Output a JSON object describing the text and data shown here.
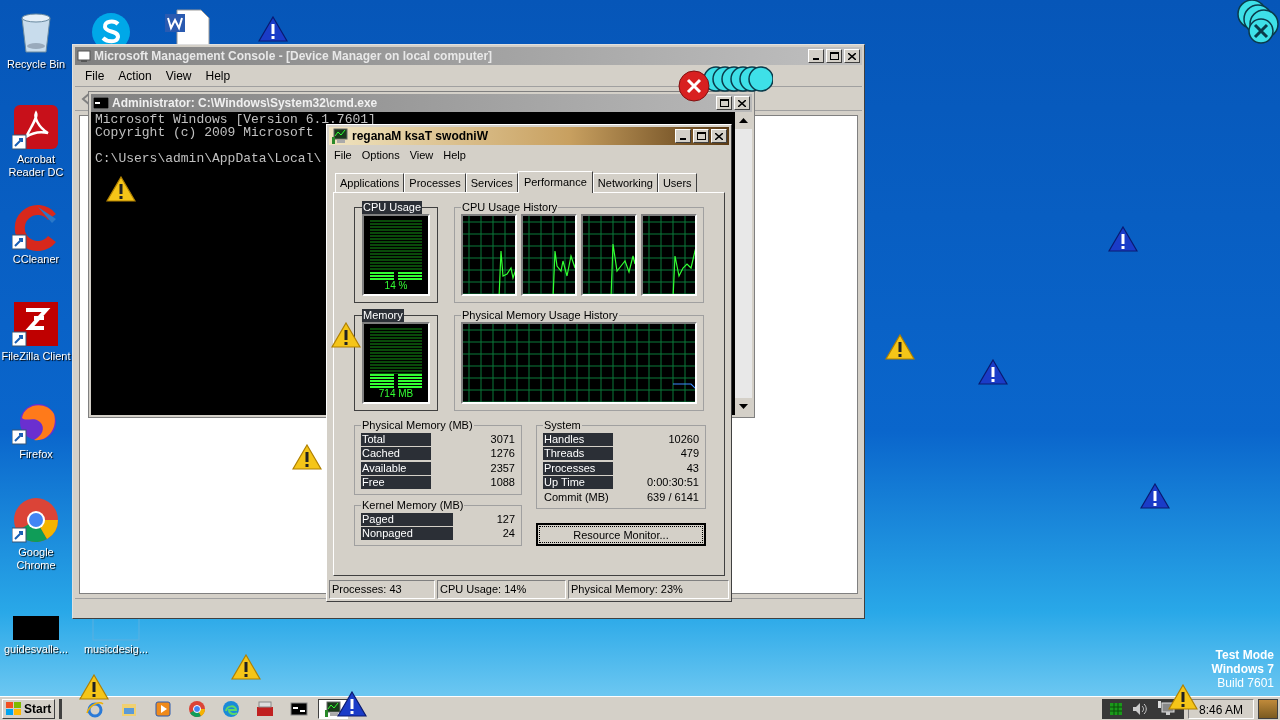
{
  "desktop_icons": [
    {
      "kind": "recycle",
      "label": "Recycle Bin"
    },
    {
      "kind": "acrobat",
      "label": "Acrobat Reader DC"
    },
    {
      "kind": "ccleaner",
      "label": "CCleaner"
    },
    {
      "kind": "filezilla",
      "label": "FileZilla Client"
    },
    {
      "kind": "firefox",
      "label": "Firefox"
    },
    {
      "kind": "chrome",
      "label": "Google Chrome"
    },
    {
      "kind": "black",
      "label": "guidesvalle..."
    },
    {
      "kind": "blank",
      "label": "musicdesig..."
    }
  ],
  "mmc": {
    "title": "Microsoft Management Console - [Device Manager on local computer]",
    "menu": [
      "File",
      "Action",
      "View",
      "Help"
    ]
  },
  "cmd": {
    "title": "Administrator: C:\\Windows\\System32\\cmd.exe",
    "blocks": [
      [
        "Microsoft Windows [Version 6.1.7601]",
        "Copyright (c) 2009 Microsoft"
      ],
      [
        "C:\\Users\\admin\\AppData\\Local\\"
      ]
    ]
  },
  "task_manager": {
    "title": "reganaM ksaT swodniW",
    "menu": [
      "File",
      "Options",
      "View",
      "Help"
    ],
    "tabs": [
      {
        "label": "Applications",
        "selected": false
      },
      {
        "label": "Processes",
        "selected": false
      },
      {
        "label": "Services",
        "selected": false
      },
      {
        "label": "Performance",
        "selected": true
      },
      {
        "label": "Networking",
        "selected": false
      },
      {
        "label": "Users",
        "selected": false
      }
    ],
    "cpu_usage": {
      "title": "CPU Usage",
      "reading": "14 %",
      "level": 0.14
    },
    "cpu_history": {
      "title": "CPU Usage History"
    },
    "memory": {
      "title": "Memory",
      "reading": "714 MB",
      "level": 0.23
    },
    "memory_history": {
      "title": "Physical Memory Usage History"
    },
    "physical_memory": {
      "title": "Physical Memory (MB)",
      "rows": [
        {
          "label": "Total",
          "value": "3071",
          "highlighted": true
        },
        {
          "label": "Cached",
          "value": "1276",
          "highlighted": true
        },
        {
          "label": "Available",
          "value": "2357",
          "highlighted": true
        },
        {
          "label": "Free",
          "value": "1088",
          "highlighted": true
        }
      ]
    },
    "kernel_memory": {
      "title": "Kernel Memory (MB)",
      "rows": [
        {
          "label": "Paged",
          "value": "127",
          "highlighted": true
        },
        {
          "label": "Nonpaged",
          "value": "24",
          "highlighted": true
        }
      ]
    },
    "system": {
      "title": "System",
      "rows": [
        {
          "label": "Handles",
          "value": "10260",
          "highlighted": true
        },
        {
          "label": "Threads",
          "value": "479",
          "highlighted": true
        },
        {
          "label": "Processes",
          "value": "43",
          "highlighted": true
        },
        {
          "label": "Up Time",
          "value": "0:00:30:51",
          "highlighted": true
        },
        {
          "label": "Commit (MB)",
          "value": "639 / 6141",
          "highlighted": false
        }
      ]
    },
    "resource_button": "Resource Monitor...",
    "status_bar": [
      "Processes: 43",
      "CPU Usage: 14%",
      "Physical Memory: 23%"
    ]
  },
  "desktop_notice": [
    "Test Mode",
    "Windows 7",
    "Build 7601"
  ],
  "taskbar": {
    "start": "Start",
    "items": [
      {
        "kind": "ie",
        "selected": false
      },
      {
        "kind": "explorer",
        "selected": false
      },
      {
        "kind": "media",
        "selected": false
      },
      {
        "kind": "chrome",
        "selected": false
      },
      {
        "kind": "edge",
        "selected": false
      },
      {
        "kind": "toolbox",
        "selected": false
      },
      {
        "kind": "cmd",
        "selected": false
      },
      {
        "kind": "taskmgr",
        "selected": true
      }
    ],
    "clock": "8:46 AM"
  }
}
